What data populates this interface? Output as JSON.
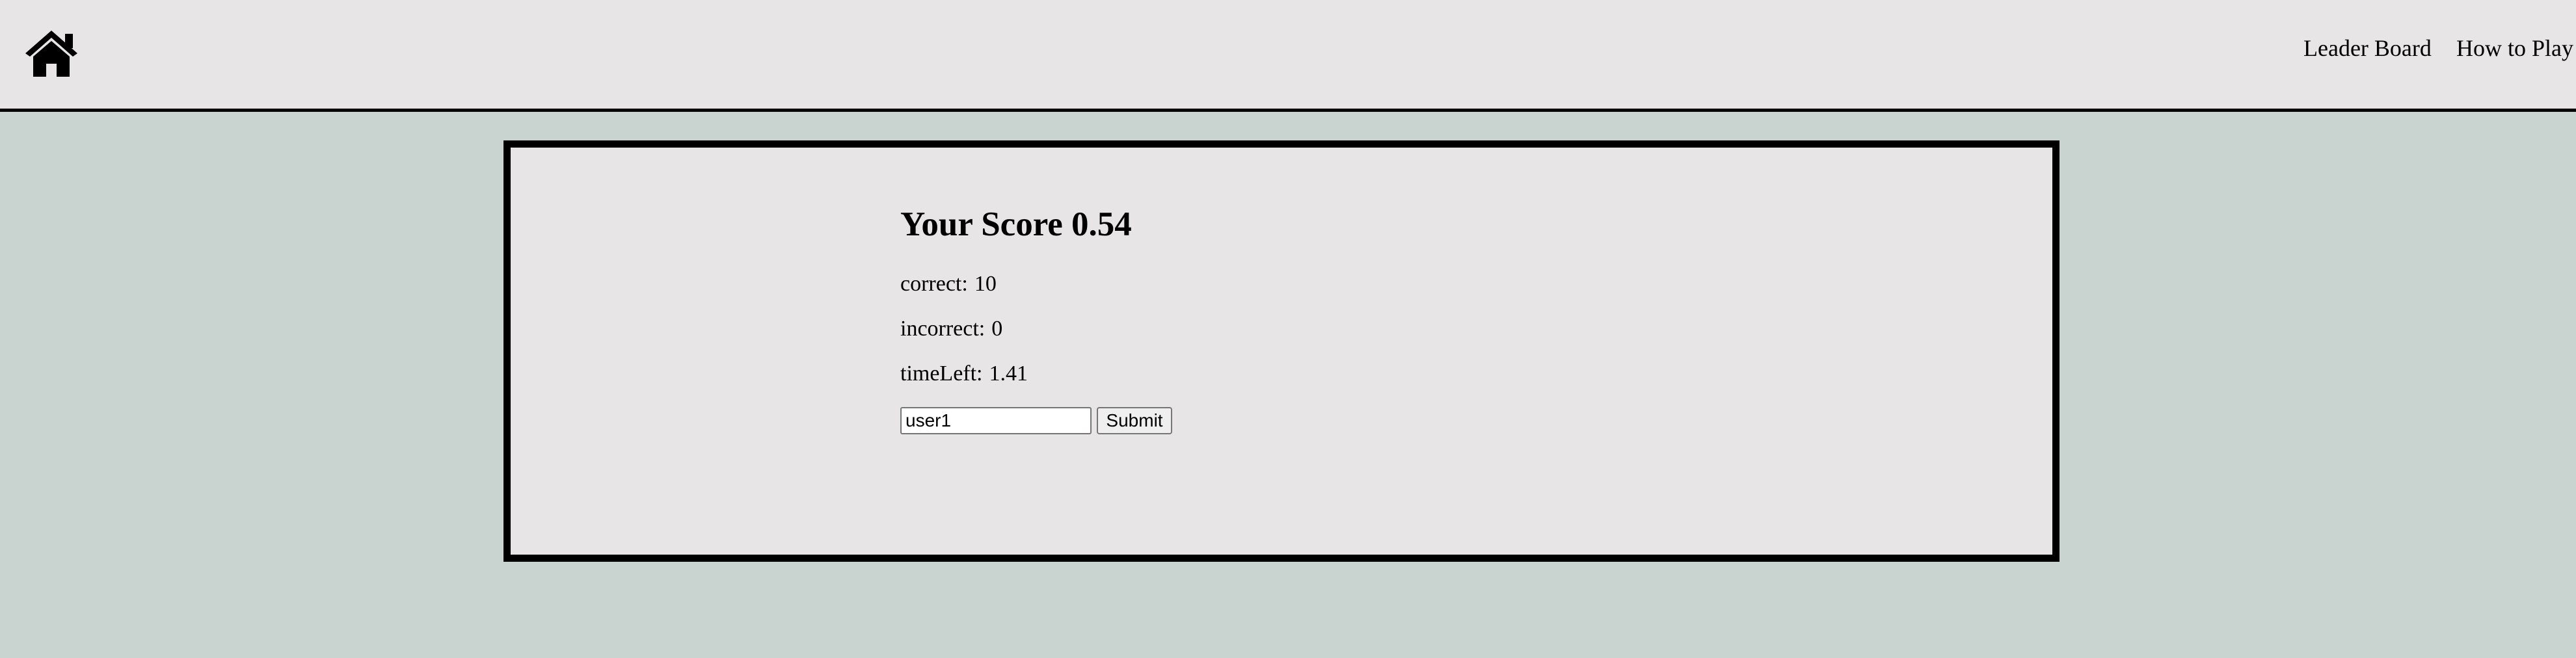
{
  "navbar": {
    "home_icon": "home-icon",
    "links": {
      "leaderboard": "Leader Board",
      "how_to_play": "How to Play"
    }
  },
  "score": {
    "title_prefix": "Your Score",
    "value": "0.54",
    "correct_label": "correct:",
    "correct_value": "10",
    "incorrect_label": "incorrect:",
    "incorrect_value": "0",
    "time_left_label": "timeLeft:",
    "time_left_value": "1.41"
  },
  "form": {
    "name_value": "user1",
    "submit_label": "Submit"
  },
  "colors": {
    "page_background": "#c9d3d0",
    "panel_background": "#e7e5e6",
    "border": "#000000"
  }
}
